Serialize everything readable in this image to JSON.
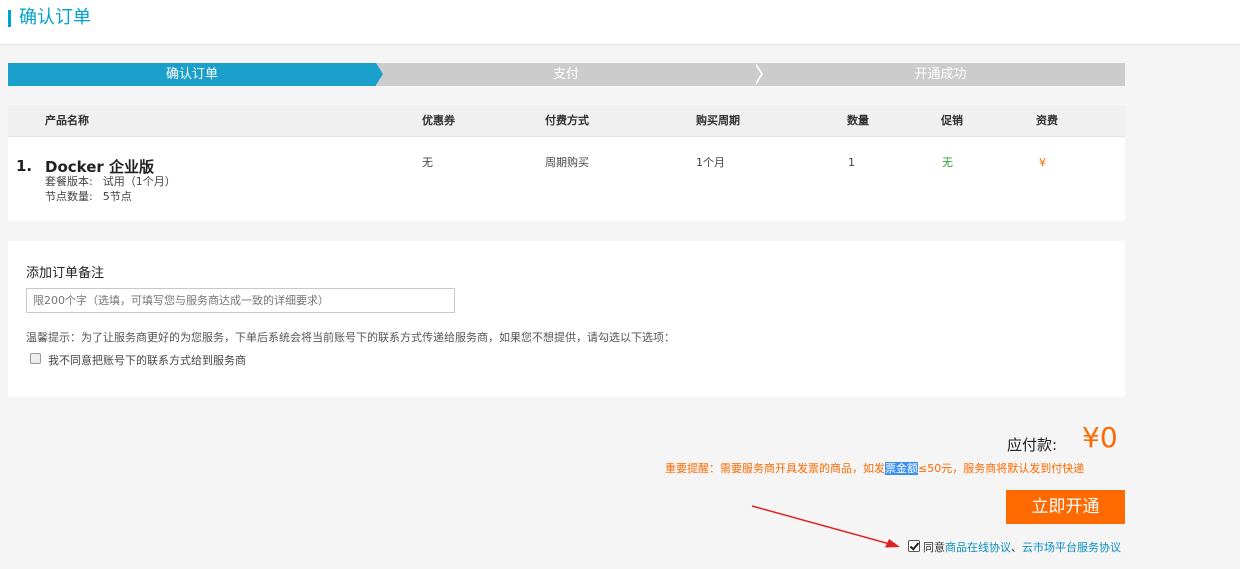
{
  "header": {
    "title": "确认订单"
  },
  "steps": [
    "确认订单",
    "支付",
    "开通成功"
  ],
  "table": {
    "columns": [
      "产品名称",
      "优惠券",
      "付费方式",
      "购买周期",
      "数量",
      "促销",
      "资费"
    ],
    "rows": [
      {
        "index": "1.",
        "product": "Docker 企业版",
        "spec_1_label": "套餐版本:",
        "spec_1_value": "试用（1个月）",
        "spec_2_label": "节点数量:",
        "spec_2_value": "5节点",
        "coupon": "无",
        "payment": "周期购买",
        "period": "1个月",
        "quantity": "1",
        "promotion": "无",
        "fee": "¥"
      }
    ]
  },
  "remark": {
    "title": "添加订单备注",
    "placeholder": "限200个字（选填，可填写您与服务商达成一致的详细要求）",
    "tip": "温馨提示：为了让服务商更好的为您服务，下单后系统会将当前账号下的联系方式传递给服务商，如果您不想提供，请勾选以下选项：",
    "checkbox_label": "我不同意把账号下的联系方式给到服务商"
  },
  "summary": {
    "pay_label": "应付款:",
    "pay_amount": "¥0",
    "notice_pre": "重要提醒：需要服务商开具发票的商品，如发",
    "notice_hl": "票金额",
    "notice_post": "≤50元，服务商将默认发到付快递",
    "button": "立即开通",
    "agree_pre": "同意",
    "agree_link_1": "商品在线协议",
    "agree_sep": "、",
    "agree_link_2": "云市场平台服务协议"
  },
  "colors": {
    "accent": "#1aa0cb",
    "orange": "#ff6a00",
    "green": "#2aa52a",
    "link": "#0a8fbf",
    "arrow": "#e02020"
  }
}
